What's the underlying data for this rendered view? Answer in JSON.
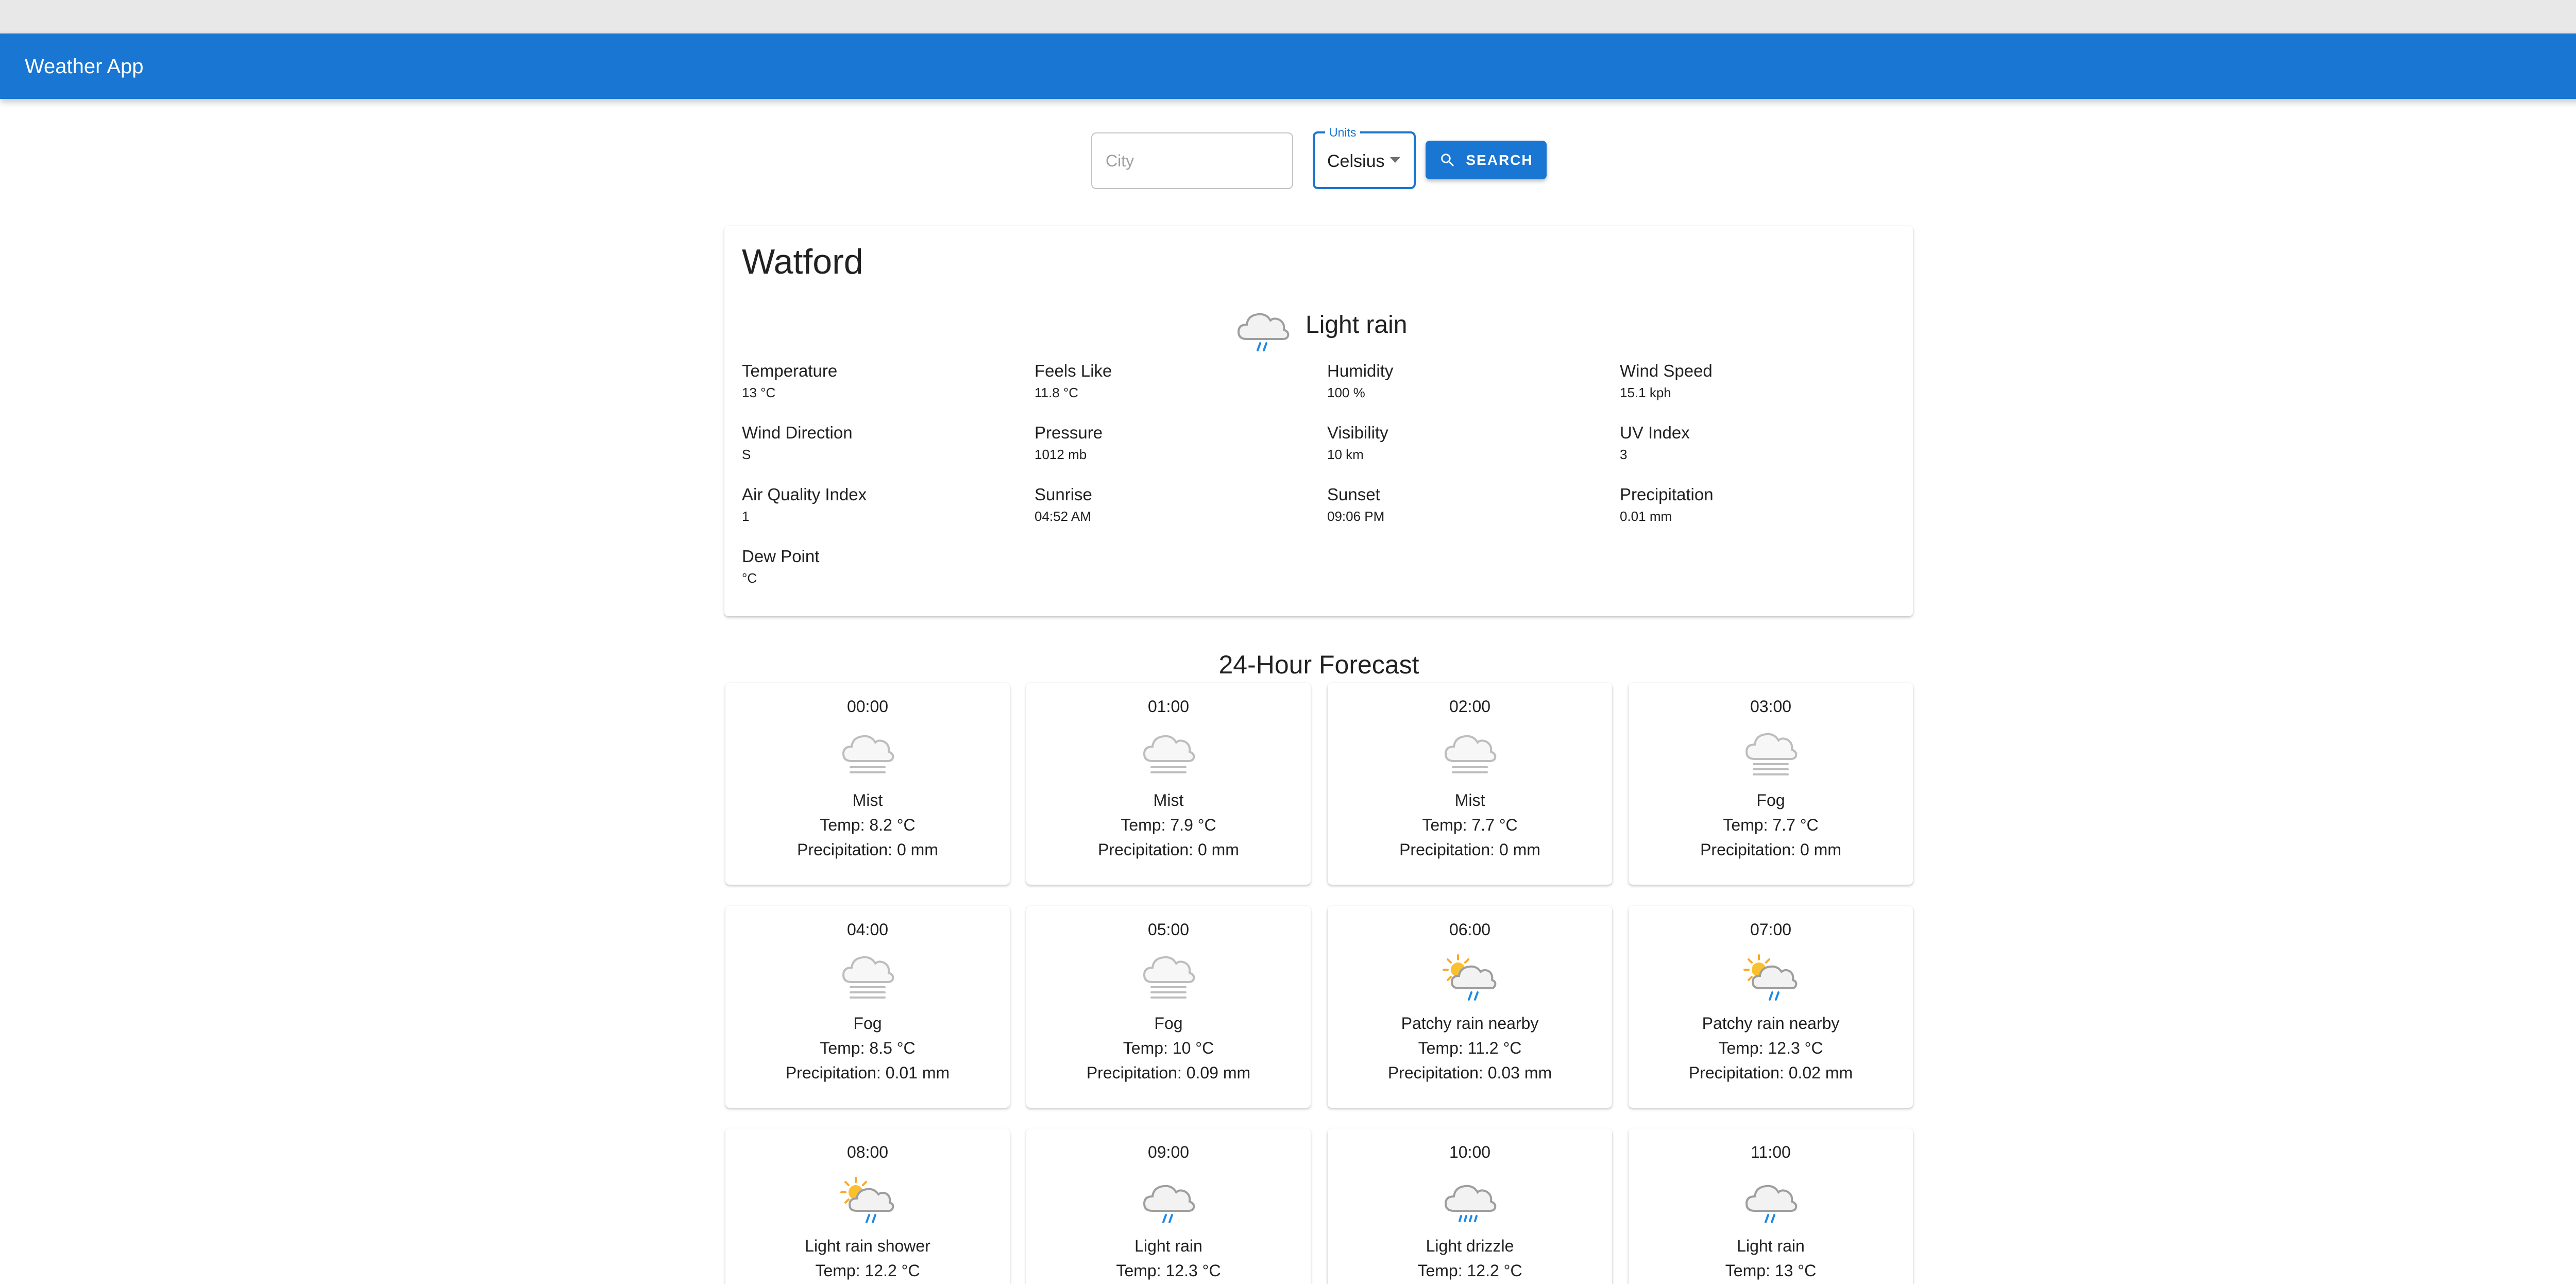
{
  "app": {
    "title": "Weather App",
    "theme_icon": "brightness-icon"
  },
  "search": {
    "city_placeholder": "City",
    "city_value": "",
    "units_label": "Units",
    "units_value": "Celsius",
    "button_label": "SEARCH",
    "button_icon": "search-icon"
  },
  "current": {
    "city": "Watford",
    "condition": "Light rain",
    "condition_icon": "light-rain-icon",
    "metrics": [
      {
        "label": "Temperature",
        "value": "13 °C"
      },
      {
        "label": "Feels Like",
        "value": "11.8 °C"
      },
      {
        "label": "Humidity",
        "value": "100 %"
      },
      {
        "label": "Wind Speed",
        "value": "15.1 kph"
      },
      {
        "label": "Wind Direction",
        "value": "S"
      },
      {
        "label": "Pressure",
        "value": "1012 mb"
      },
      {
        "label": "Visibility",
        "value": "10 km"
      },
      {
        "label": "UV Index",
        "value": "3"
      },
      {
        "label": "Air Quality Index",
        "value": "1"
      },
      {
        "label": "Sunrise",
        "value": "04:52 AM"
      },
      {
        "label": "Sunset",
        "value": "09:06 PM"
      },
      {
        "label": "Precipitation",
        "value": "0.01 mm"
      },
      {
        "label": "Dew Point",
        "value": "°C"
      }
    ]
  },
  "forecast": {
    "title": "24-Hour Forecast",
    "temp_prefix": "Temp: ",
    "precip_prefix": "Precipitation: ",
    "hours": [
      {
        "time": "00:00",
        "condition": "Mist",
        "icon": "mist-icon",
        "temp": "8.2 °C",
        "precip": "0 mm"
      },
      {
        "time": "01:00",
        "condition": "Mist",
        "icon": "mist-icon",
        "temp": "7.9 °C",
        "precip": "0 mm"
      },
      {
        "time": "02:00",
        "condition": "Mist",
        "icon": "mist-icon",
        "temp": "7.7 °C",
        "precip": "0 mm"
      },
      {
        "time": "03:00",
        "condition": "Fog",
        "icon": "fog-icon",
        "temp": "7.7 °C",
        "precip": "0 mm"
      },
      {
        "time": "04:00",
        "condition": "Fog",
        "icon": "fog-icon",
        "temp": "8.5 °C",
        "precip": "0.01 mm"
      },
      {
        "time": "05:00",
        "condition": "Fog",
        "icon": "fog-icon",
        "temp": "10 °C",
        "precip": "0.09 mm"
      },
      {
        "time": "06:00",
        "condition": "Patchy rain nearby",
        "icon": "sun-cloud-rain-icon",
        "temp": "11.2 °C",
        "precip": "0.03 mm"
      },
      {
        "time": "07:00",
        "condition": "Patchy rain nearby",
        "icon": "sun-cloud-rain-icon",
        "temp": "12.3 °C",
        "precip": "0.02 mm"
      },
      {
        "time": "08:00",
        "condition": "Light rain shower",
        "icon": "sun-cloud-rain-icon",
        "temp": "12.2 °C",
        "precip": ""
      },
      {
        "time": "09:00",
        "condition": "Light rain",
        "icon": "light-rain-icon",
        "temp": "12.3 °C",
        "precip": ""
      },
      {
        "time": "10:00",
        "condition": "Light drizzle",
        "icon": "drizzle-icon",
        "temp": "12.2 °C",
        "precip": ""
      },
      {
        "time": "11:00",
        "condition": "Light rain",
        "icon": "light-rain-icon",
        "temp": "13 °C",
        "precip": ""
      }
    ]
  },
  "colors": {
    "primary": "#1976d2",
    "cloud": "#bdbdbd",
    "rain": "#1e88e5",
    "sun": "#f9a825"
  }
}
